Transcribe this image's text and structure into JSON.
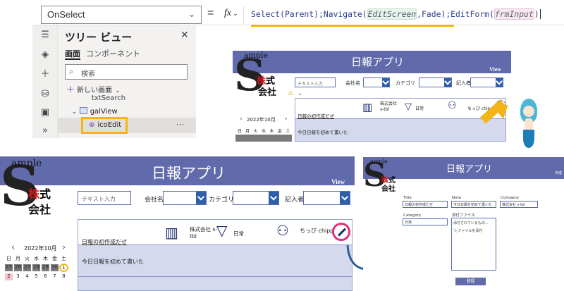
{
  "formula_bar": {
    "property": "OnSelect",
    "equals": "=",
    "fx": "fx",
    "code_part1": "Select(Parent);Navigate(",
    "code_screen": "EditScreen",
    "code_part2": ",Fade);EditForm(",
    "code_form": "frmInput",
    "code_part3": ")"
  },
  "tree_view": {
    "title": "ツリー ビュー",
    "tab_screens": "画面",
    "tab_components": "コンポーネント",
    "search_placeholder": "検索",
    "new_screen": "新しい画面",
    "items": [
      "txtSearch",
      "galView",
      "icoEdit"
    ]
  },
  "app_small": {
    "title": "日報アプリ",
    "view": "View",
    "logo": {
      "s": "S",
      "ample": "ample",
      "kabu_red": "株",
      "kabu": "式",
      "sha": "会社"
    },
    "search_placeholder": "テキスト入力",
    "filters": [
      "会社名",
      "カテゴリ",
      "記入者"
    ],
    "calendar_month": "2022年10月",
    "weekdays": [
      "日",
      "月",
      "火",
      "水",
      "木",
      "金",
      "土"
    ],
    "row": {
      "company": "株式会社 s-tbl",
      "category": "日常",
      "writer": "ちっぴ chippy",
      "title": "日報の初作成だぜ",
      "body": "今日日報を初めて書いた"
    }
  },
  "app_large": {
    "title": "日報アプリ",
    "view": "View",
    "logo": {
      "s": "S",
      "ample": "ample",
      "kabu_red": "株",
      "kabu": "式",
      "sha": "会社"
    },
    "search_placeholder": "テキスト入力",
    "filters": [
      "会社名",
      "カテゴリ",
      "記入者"
    ],
    "calendar_month": "2022年10月",
    "weekdays": [
      "日",
      "月",
      "火",
      "水",
      "木",
      "金",
      "土"
    ],
    "week1": [
      "25",
      "26",
      "27",
      "28",
      "29",
      "30",
      "1"
    ],
    "week2": [
      "2",
      "3",
      "4",
      "5",
      "6",
      "7",
      "8"
    ],
    "row": {
      "company": "株式会社 s-tbl",
      "category": "日常",
      "writer": "ちっぴ chippy",
      "title": "日報の初作成だぜ",
      "body": "今日日報を初めて書いた"
    }
  },
  "edit_screen": {
    "title": "日報アプリ",
    "action": "作成",
    "logo": {
      "s": "S",
      "ample": "ample",
      "kabu_red": "株",
      "kabu": "式",
      "sha": "会社"
    },
    "fields": {
      "title_label": "Title",
      "title_value": "日報の初作成だぜ",
      "note_label": "Note",
      "note_value": "今日日報を初めて書いた",
      "company_label": "Company",
      "company_value": "株式会社 s-tbl",
      "category_label": "Category",
      "category_value": "日常",
      "attach_label": "添付ファイル",
      "attach_empty": "添付されているもの...",
      "attach_add": "ファイルを添付"
    },
    "submit": "登録"
  },
  "colors": {
    "header": "#616bab",
    "highlight_yellow": "#f2b416",
    "highlight_pink": "#e0307a",
    "accent_blue": "#2f5fa8"
  }
}
